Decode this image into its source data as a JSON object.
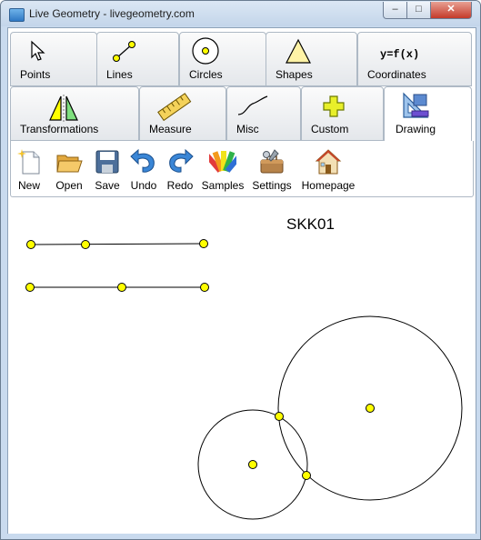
{
  "window": {
    "title": "Live Geometry - livegeometry.com",
    "minimize": "‒",
    "maximize": "□",
    "close": "✕"
  },
  "tabs": [
    {
      "label": "Points",
      "icon": "cursor-arrow-icon"
    },
    {
      "label": "Lines",
      "icon": "line-segment-icon"
    },
    {
      "label": "Circles",
      "icon": "circle-icon"
    },
    {
      "label": "Shapes",
      "icon": "triangle-icon"
    },
    {
      "label": "Coordinates",
      "icon": "function-text-icon",
      "icon_text": "y=f(x)"
    },
    {
      "label": "Transformations",
      "icon": "reflection-icon"
    },
    {
      "label": "Measure",
      "icon": "ruler-icon"
    },
    {
      "label": "Misc",
      "icon": "curve-icon"
    },
    {
      "label": "Custom",
      "icon": "plus-icon"
    },
    {
      "label": "Drawing",
      "icon": "drawing-tools-icon",
      "active": true
    }
  ],
  "toolbar": [
    {
      "label": "New",
      "icon": "new-document-icon"
    },
    {
      "label": "Open",
      "icon": "open-folder-icon"
    },
    {
      "label": "Save",
      "icon": "floppy-disk-icon"
    },
    {
      "label": "Undo",
      "icon": "undo-arrow-icon"
    },
    {
      "label": "Redo",
      "icon": "redo-arrow-icon"
    },
    {
      "label": "Samples",
      "icon": "color-palette-icon"
    },
    {
      "label": "Settings",
      "icon": "toolbox-icon"
    },
    {
      "label": "Homepage",
      "icon": "house-icon"
    }
  ],
  "canvas": {
    "label": "SKK01",
    "point_color": "#ffff00",
    "stroke_color": "#000000"
  }
}
